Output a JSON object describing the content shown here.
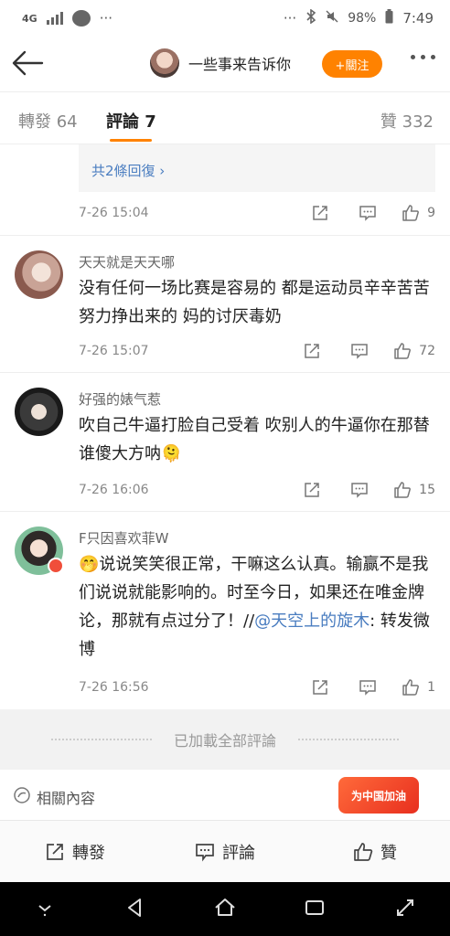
{
  "status": {
    "network": "4G",
    "dots": "···",
    "right_dots": "···",
    "battery": "98%",
    "time": "7:49"
  },
  "header": {
    "title": "一些事来告诉你",
    "follow_label": "+關注"
  },
  "tabs": {
    "repost": "轉發 64",
    "comment": "評論 7",
    "like": "贊 332"
  },
  "replies_link": "共2條回復 ›",
  "comments": [
    {
      "time": "7-26 15:04",
      "likes": "9"
    },
    {
      "name": "天天就是天天哪",
      "text": "没有任何一场比赛是容易的 都是运动员辛辛苦苦努力挣出来的 妈的讨厌毒奶",
      "time": "7-26 15:07",
      "likes": "72"
    },
    {
      "name": "好强的婊气惹",
      "text": "吹自己牛逼打脸自己受着 吹别人的牛逼你在那替谁傻大方呐🫠",
      "time": "7-26 16:06",
      "likes": "15"
    },
    {
      "name": "F只因喜欢菲W",
      "text_before": "🤭说说笑笑很正常，干嘛这么认真。输赢不是我们说说就能影响的。时至今日，如果还在唯金牌论，那就有点过分了！//",
      "mention": "@天空上的旋木",
      "text_after": ": 转发微博",
      "time": "7-26 16:56",
      "likes": "1"
    }
  ],
  "loaded_all": "已加載全部評論",
  "related": {
    "label": "相關內容",
    "promo": "为中国加油"
  },
  "toolbar": {
    "repost": "轉發",
    "comment": "評論",
    "like": "贊"
  },
  "colors": {
    "accent": "#ff8200",
    "link": "#4a7dc0"
  }
}
